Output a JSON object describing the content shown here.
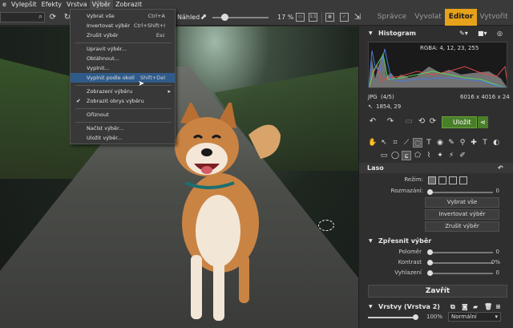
{
  "menubar": {
    "items": [
      "e",
      "Vylepšit",
      "Efekty",
      "Vrstva",
      "Výběr",
      "Zobrazit"
    ],
    "open_index": 4
  },
  "toolbar": {
    "search_placeholder": "",
    "preview_label": "Náhled",
    "zoom_label": "17 %",
    "zoom_fraction": 0.17,
    "icons": [
      "search-icon",
      "refresh-icon",
      "rotate-icon",
      "preview-checkbox-icon",
      "external-icon",
      "fit-icon",
      "one-to-one-icon",
      "grid-icon",
      "checkbox-icon",
      "export-icon"
    ]
  },
  "modules": {
    "tabs": [
      "Správce",
      "Vyvolat",
      "Editor",
      "Vytvořit"
    ],
    "active": "Editor",
    "accent_color": "#e6a21a"
  },
  "menu": {
    "items": [
      {
        "label": "Vybrat vše",
        "shortcut": "Ctrl+A"
      },
      {
        "label": "Invertovat výběr",
        "shortcut": "Ctrl+Shift+I"
      },
      {
        "label": "Zrušit výběr",
        "shortcut": "Esc"
      },
      {
        "label": "Upravit výběr..."
      },
      {
        "label": "Obtáhnout..."
      },
      {
        "label": "Vyplnit..."
      },
      {
        "label": "Vyplnit podle okolí",
        "shortcut": "Shift+Del",
        "highlighted": true
      },
      {
        "label": "Zobrazení výběru",
        "submenu": true
      },
      {
        "label": "Zobrazit obrys výběru",
        "checked": true
      },
      {
        "label": "Oříznout"
      },
      {
        "label": "Načíst výběr..."
      },
      {
        "label": "Uložit výběr..."
      }
    ]
  },
  "panel": {
    "histogram_title": "Histogram",
    "rgba_label": "RGBA:  4,  12,  23, 255",
    "file_type": "JPG",
    "file_index": "(4/5)",
    "dimensions": "6016 x 4016 x 24",
    "coords": "1854, 29",
    "save_label": "Uložit",
    "lasso_title": "Laso",
    "mode_label": "Režim:",
    "blur_label": "Rozmazání:",
    "blur_value": "0",
    "select_all_button": "Vybrat vše",
    "invert_button": "Invertovat výběr",
    "cancel_button": "Zrušit výběr",
    "refine_title": "Zpřesnit výběr",
    "radius_label": "Poloměr",
    "radius_value": "0",
    "contrast_label": "Kontrast",
    "contrast_value": "0%",
    "smoothing_label": "Vyhlazení",
    "smoothing_value": "0",
    "close_button": "Zavřít",
    "layers_title": "Vrstvy (Vrstva 2)",
    "opacity_label": "100%",
    "blend_mode": "Normální"
  }
}
